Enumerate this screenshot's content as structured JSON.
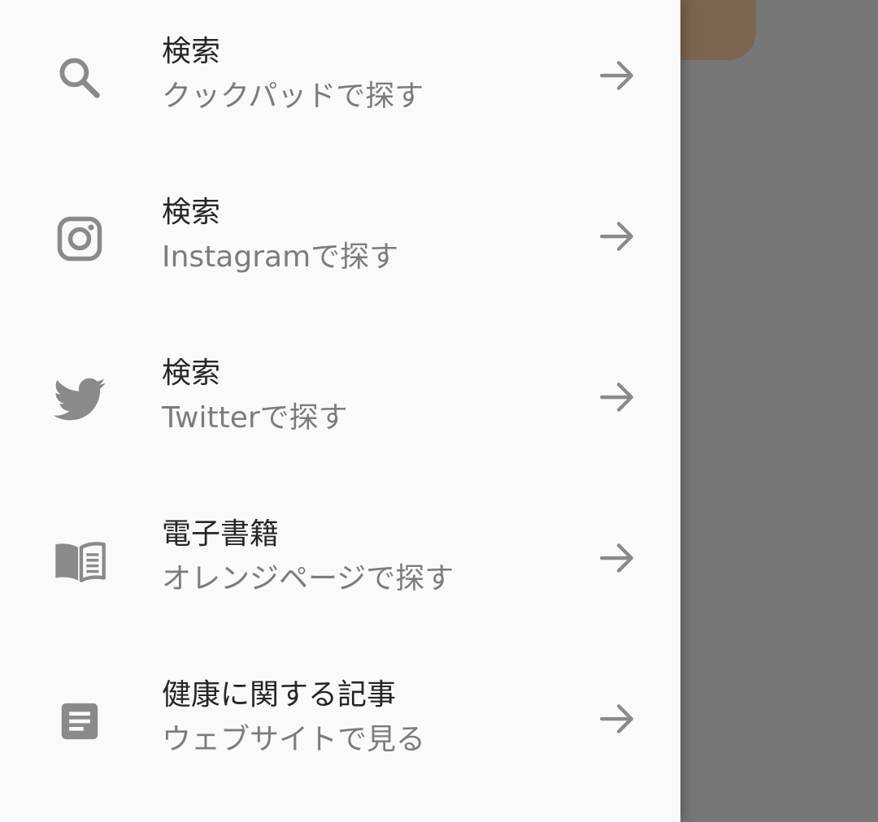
{
  "colors": {
    "drawer_background": "#fafafa",
    "scrim": "#777777",
    "background_card": "#7a6650",
    "title_text": "#262626",
    "subtitle_text": "#7c7c7c",
    "icon": "#8a8a8a"
  },
  "drawer": {
    "items": [
      {
        "icon": "search-icon",
        "title": "検索",
        "subtitle": "クックパッドで探す",
        "trailing_icon": "arrow-right-icon"
      },
      {
        "icon": "instagram-icon",
        "title": "検索",
        "subtitle": "Instagramで探す",
        "trailing_icon": "arrow-right-icon"
      },
      {
        "icon": "twitter-icon",
        "title": "検索",
        "subtitle": "Twitterで探す",
        "trailing_icon": "arrow-right-icon"
      },
      {
        "icon": "book-icon",
        "title": "電子書籍",
        "subtitle": "オレンジページで探す",
        "trailing_icon": "arrow-right-icon"
      },
      {
        "icon": "article-icon",
        "title": "健康に関する記事",
        "subtitle": "ウェブサイトで見る",
        "trailing_icon": "arrow-right-icon"
      }
    ]
  }
}
